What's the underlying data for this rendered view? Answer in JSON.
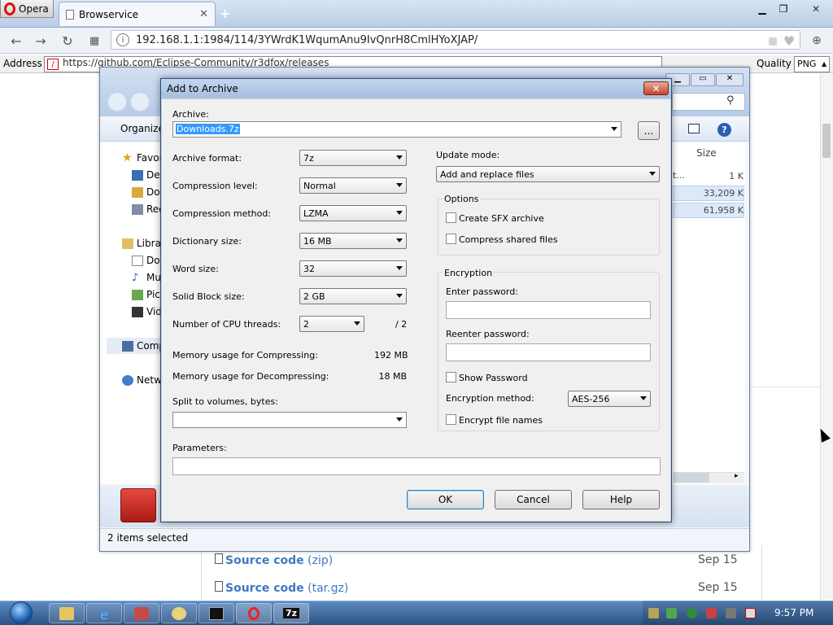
{
  "browser": {
    "menu_label": "Opera",
    "tab_title": "Browservice",
    "url": "192.168.1.1:1984/114/3YWrdK1WqumAnu9IvQnrH8CmlHYoXJAP/",
    "address_label": "Address",
    "address_value": "https://github.com/Eclipse-Community/r3dfox/releases",
    "quality_label": "Quality",
    "quality_value": "PNG"
  },
  "webpage": {
    "assets": [
      {
        "name_bold": "Source code",
        "name_ext": " (zip)",
        "date": "Sep 15"
      },
      {
        "name_bold": "Source code",
        "name_ext": " (tar.gz)",
        "date": "Sep 15"
      }
    ]
  },
  "explorer": {
    "organize_label": "Organize",
    "nav": {
      "favorites": "Favorites",
      "desktop": "Desktop",
      "downloads": "Downloads",
      "recent": "Recent Places",
      "libraries": "Libraries",
      "documents": "Documents",
      "music": "Music",
      "pictures": "Pictures",
      "videos": "Videos",
      "computer": "Computer",
      "network": "Network"
    },
    "size_header": "Size",
    "row_cut": "t...",
    "sizes": [
      "1 K",
      "33,209 K",
      "61,958 K"
    ],
    "status": "2 items selected"
  },
  "dialog": {
    "title": "Add to Archive",
    "archive_label": "Archive:",
    "archive_value": "Downloads.7z",
    "browse_label": "...",
    "archive_format_label": "Archive format:",
    "archive_format_value": "7z",
    "compression_level_label": "Compression level:",
    "compression_level_value": "Normal",
    "compression_method_label": "Compression method:",
    "compression_method_value": "LZMA",
    "dictionary_size_label": "Dictionary size:",
    "dictionary_size_value": "16 MB",
    "word_size_label": "Word size:",
    "word_size_value": "32",
    "solid_block_label": "Solid Block size:",
    "solid_block_value": "2 GB",
    "cpu_threads_label": "Number of CPU threads:",
    "cpu_threads_value": "2",
    "cpu_threads_max": "/ 2",
    "mem_compress_label": "Memory usage for Compressing:",
    "mem_compress_value": "192 MB",
    "mem_decompress_label": "Memory usage for Decompressing:",
    "mem_decompress_value": "18 MB",
    "split_label": "Split to volumes, bytes:",
    "split_value": "",
    "parameters_label": "Parameters:",
    "parameters_value": "",
    "update_mode_label": "Update mode:",
    "update_mode_value": "Add and replace files",
    "options_label": "Options",
    "create_sfx_label": "Create SFX archive",
    "compress_shared_label": "Compress shared files",
    "encryption_label": "Encryption",
    "enter_password_label": "Enter password:",
    "reenter_password_label": "Reenter password:",
    "show_password_label": "Show Password",
    "encryption_method_label": "Encryption method:",
    "encryption_method_value": "AES-256",
    "encrypt_names_label": "Encrypt file names",
    "ok_label": "OK",
    "cancel_label": "Cancel",
    "help_label": "Help"
  },
  "taskbar": {
    "clock": "9:57 PM",
    "sevenzip_label": "7z"
  }
}
